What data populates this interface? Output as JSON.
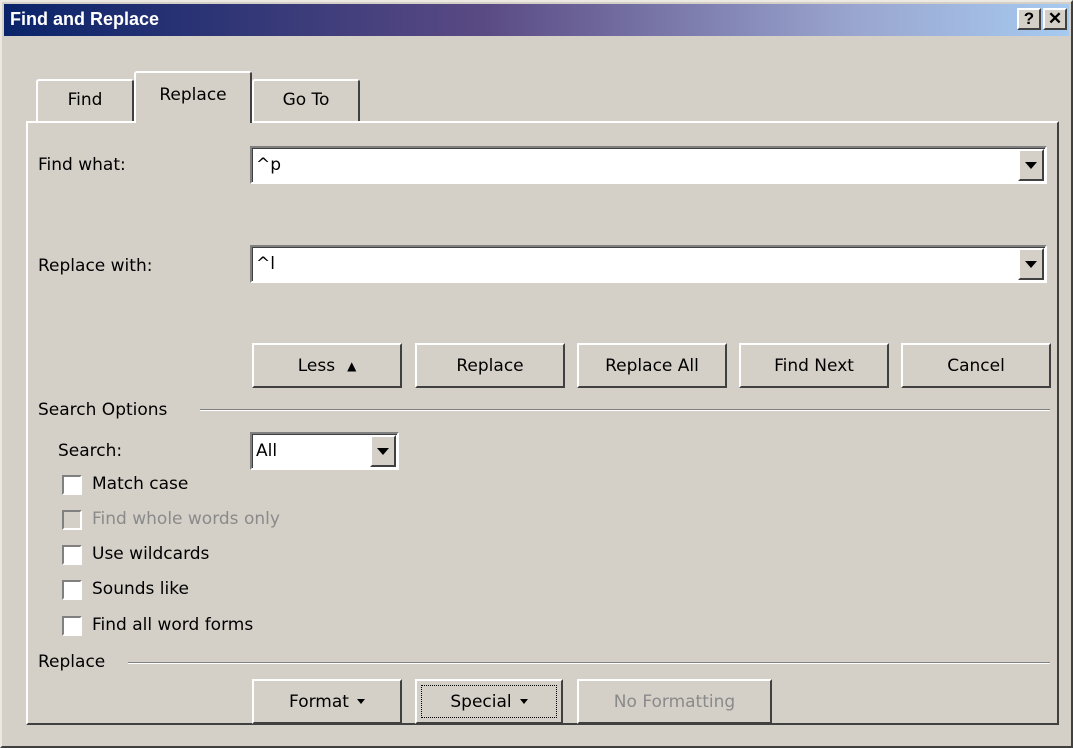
{
  "window": {
    "title": "Find and Replace"
  },
  "titlebar_buttons": {
    "help_label": "?",
    "close_label": "✕"
  },
  "tabs": [
    {
      "label": "Find",
      "active": false
    },
    {
      "label": "Replace",
      "active": true
    },
    {
      "label": "Go To",
      "active": false
    }
  ],
  "find_what": {
    "label": "Find what:",
    "value": "^p"
  },
  "replace_with": {
    "label": "Replace with:",
    "value": "^l"
  },
  "action_buttons": {
    "less": "Less",
    "replace": "Replace",
    "replace_all": "Replace All",
    "find_next": "Find Next",
    "cancel": "Cancel"
  },
  "search_options": {
    "heading": "Search Options",
    "search_label": "Search:",
    "search_value": "All",
    "checkboxes": [
      {
        "label": "Match case",
        "checked": false,
        "enabled": true
      },
      {
        "label": "Find whole words only",
        "checked": false,
        "enabled": false
      },
      {
        "label": "Use wildcards",
        "checked": false,
        "enabled": true
      },
      {
        "label": "Sounds like",
        "checked": false,
        "enabled": true
      },
      {
        "label": "Find all word forms",
        "checked": false,
        "enabled": true
      }
    ]
  },
  "replace_section": {
    "heading": "Replace",
    "format": "Format",
    "special": "Special",
    "no_formatting": "No Formatting"
  },
  "colors": {
    "face": "#d4d0c8",
    "title_start": "#0a246a",
    "title_end": "#a6caf0"
  }
}
